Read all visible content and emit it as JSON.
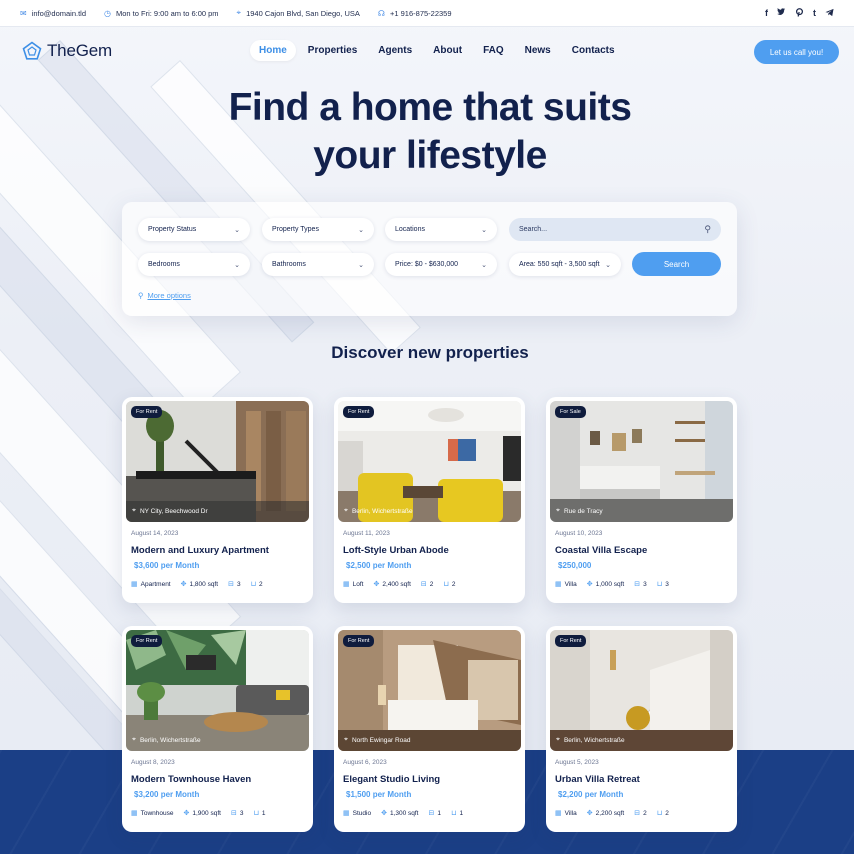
{
  "topbar": {
    "email": "info@domain.tld",
    "hours": "Mon to Fri: 9:00 am to 6:00 pm",
    "address": "1940 Cajon Blvd, San Diego, USA",
    "phone": "+1 916-875-22359",
    "social": [
      "f",
      "t",
      "p",
      "t",
      "tg"
    ]
  },
  "header": {
    "logo": "TheGem",
    "nav": [
      "Home",
      "Properties",
      "Agents",
      "About",
      "FAQ",
      "News",
      "Contacts"
    ],
    "active_nav": "Home",
    "cta": "Let us call you!"
  },
  "hero": {
    "title_line1": "Find a home that suits",
    "title_line2": "your lifestyle"
  },
  "search": {
    "property_status": "Property Status",
    "property_types": "Property Types",
    "locations": "Locations",
    "search_placeholder": "Search...",
    "bedrooms": "Bedrooms",
    "bathrooms": "Bathrooms",
    "price": "Price: $0 - $630,000",
    "area": "Area: 550 sqft - 3,500 sqft",
    "search_button": "Search",
    "more_options": "More options"
  },
  "section_title": "Discover new properties",
  "colors": {
    "accent": "#4f9ef0",
    "navy": "#12214d",
    "band": "#1b3f86"
  },
  "listings": [
    {
      "badge": "For Rent",
      "location": "NY City, Beechwood Dr",
      "date": "August 14, 2023",
      "title": "Modern and Luxury Apartment",
      "price": "$3,600 per Month",
      "type": "Apartment",
      "area": "1,800 sqft",
      "beds": "3",
      "baths": "2"
    },
    {
      "badge": "For Rent",
      "location": "Berlin, Wichertstraße",
      "date": "August 11, 2023",
      "title": "Loft-Style Urban Abode",
      "price": "$2,500 per Month",
      "type": "Loft",
      "area": "2,400 sqft",
      "beds": "2",
      "baths": "2"
    },
    {
      "badge": "For Sale",
      "location": "Rue de Tracy",
      "date": "August 10, 2023",
      "title": "Coastal Villa Escape",
      "price": "$250,000",
      "type": "Villa",
      "area": "1,000 sqft",
      "beds": "3",
      "baths": "3"
    },
    {
      "badge": "For Rent",
      "location": "Berlin, Wichertstraße",
      "date": "August 8, 2023",
      "title": "Modern Townhouse Haven",
      "price": "$3,200 per Month",
      "type": "Townhouse",
      "area": "1,900 sqft",
      "beds": "3",
      "baths": "1"
    },
    {
      "badge": "For Rent",
      "location": "North Ewingar Road",
      "date": "August 6, 2023",
      "title": "Elegant Studio Living",
      "price": "$1,500 per Month",
      "type": "Studio",
      "area": "1,300 sqft",
      "beds": "1",
      "baths": "1"
    },
    {
      "badge": "For Rent",
      "location": "Berlin, Wichertstraße",
      "date": "August 5, 2023",
      "title": "Urban Villa Retreat",
      "price": "$2,200 per Month",
      "type": "Villa",
      "area": "2,200 sqft",
      "beds": "2",
      "baths": "2"
    }
  ]
}
